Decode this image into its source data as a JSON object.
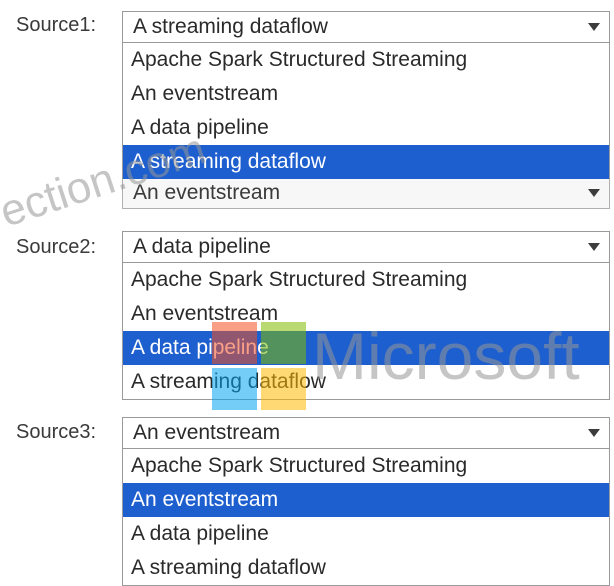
{
  "sources": [
    {
      "label": "Source1:",
      "selected": "A streaming dataflow",
      "options": [
        "Apache Spark Structured Streaming",
        "An eventstream",
        "A data pipeline",
        "A streaming dataflow"
      ],
      "highlighted_index": 3,
      "underlying_value": "An eventstream"
    },
    {
      "label": "Source2:",
      "selected": "A data pipeline",
      "options": [
        "Apache Spark Structured Streaming",
        "An eventstream",
        "A data pipeline",
        "A streaming dataflow"
      ],
      "highlighted_index": 2
    },
    {
      "label": "Source3:",
      "selected": "An eventstream",
      "options": [
        "Apache Spark Structured Streaming",
        "An eventstream",
        "A data pipeline",
        "A streaming dataflow"
      ],
      "highlighted_index": 1
    }
  ],
  "watermark": {
    "site": "ection.com",
    "brand": "Microsoft",
    "logo_colors": [
      "#f25022",
      "#7fba00",
      "#00a4ef",
      "#ffb900"
    ]
  },
  "colors": {
    "highlight": "#1e5fcf"
  },
  "icons": {
    "dropdown": "chevron-down-icon"
  }
}
